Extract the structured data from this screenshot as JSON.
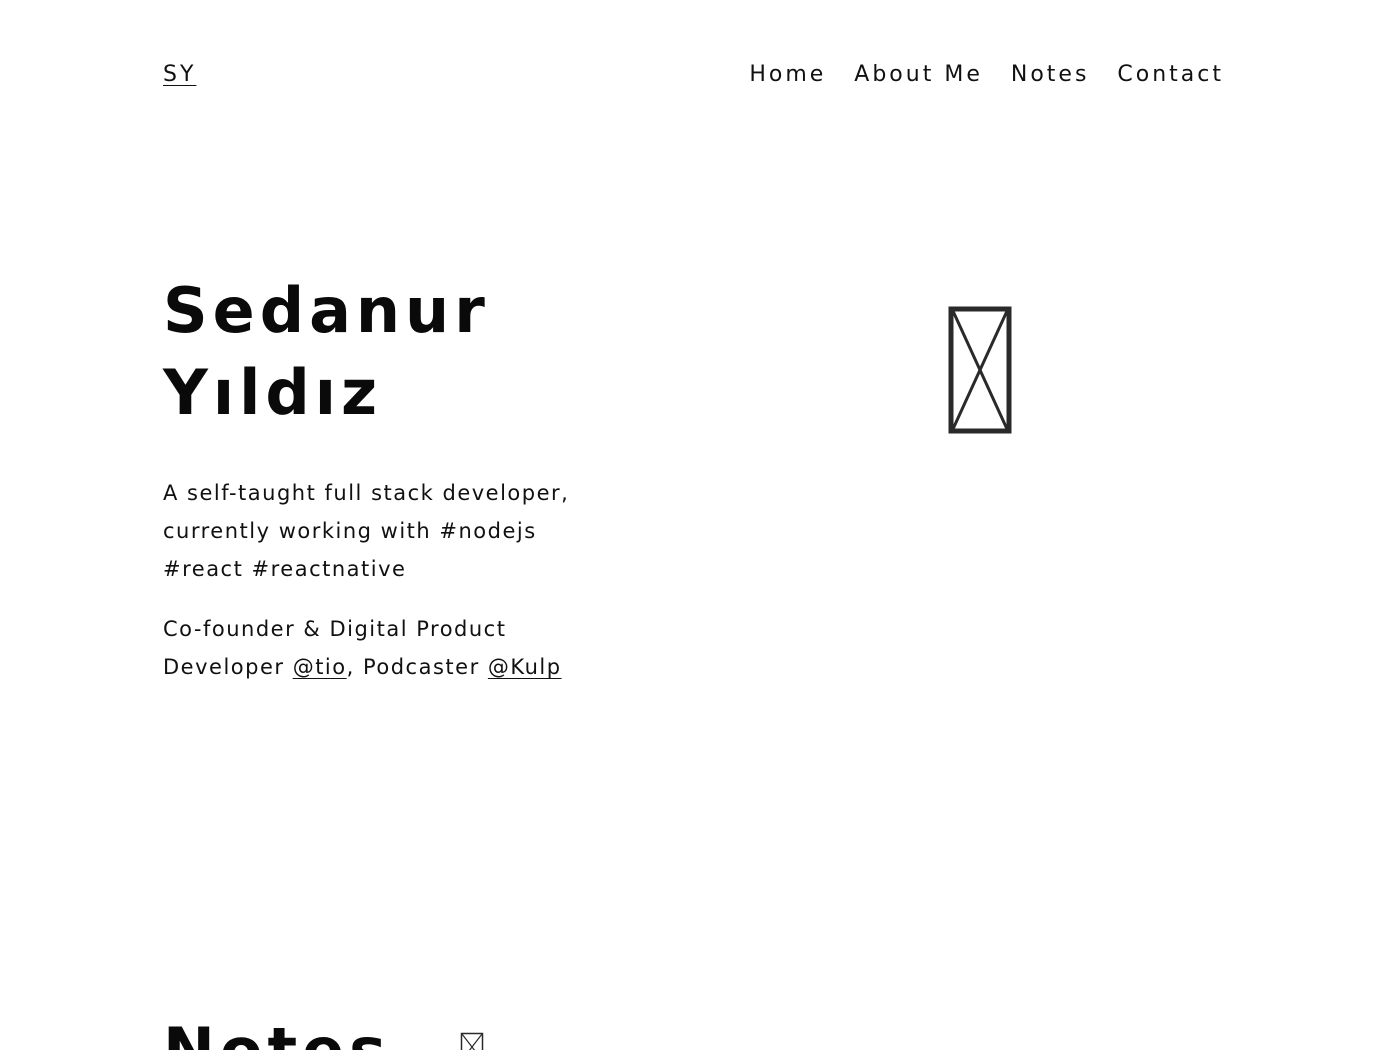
{
  "header": {
    "logo": "SY",
    "nav": [
      "Home",
      "About Me",
      "Notes",
      "Contact"
    ]
  },
  "hero": {
    "name_line1": "Sedanur",
    "name_line2": "Yıldız",
    "bio_line1": "A self-taught full stack developer,",
    "bio_line2": "currently working with #nodejs",
    "bio_line3": "#react #reactnative",
    "role_line1": "Co-founder & Digital Product",
    "role_prefix": "Developer ",
    "role_link1": "@tio",
    "role_middle": ", Podcaster ",
    "role_link2": "@Kulp",
    "image_icon": "broken-image-icon"
  },
  "notes": {
    "heading": "Notes",
    "icon": "broken-image-icon"
  }
}
